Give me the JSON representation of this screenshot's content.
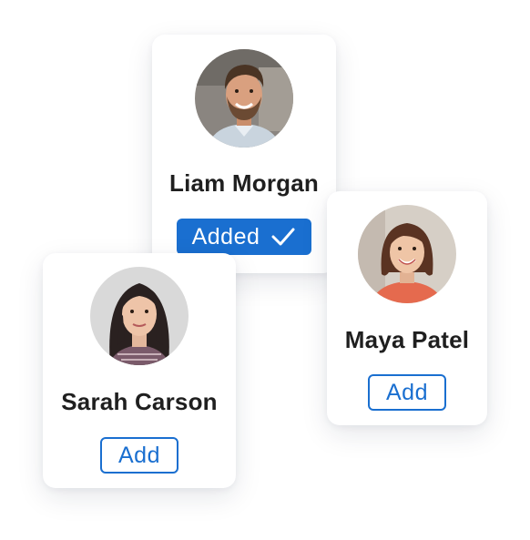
{
  "colors": {
    "accent": "#1a6fd0",
    "card_bg": "#ffffff",
    "name_text": "#1f1f1f"
  },
  "cards": [
    {
      "name": "Liam Morgan",
      "button_label": "Added",
      "button_state": "added",
      "button_icon": "checkmark-icon",
      "avatar": "avatar-photo-man-smiling-beard"
    },
    {
      "name": "Maya Patel",
      "button_label": "Add",
      "button_state": "add",
      "avatar": "avatar-photo-woman-smiling-bob-hair"
    },
    {
      "name": "Sarah Carson",
      "button_label": "Add",
      "button_state": "add",
      "avatar": "avatar-photo-woman-long-dark-hair"
    }
  ]
}
